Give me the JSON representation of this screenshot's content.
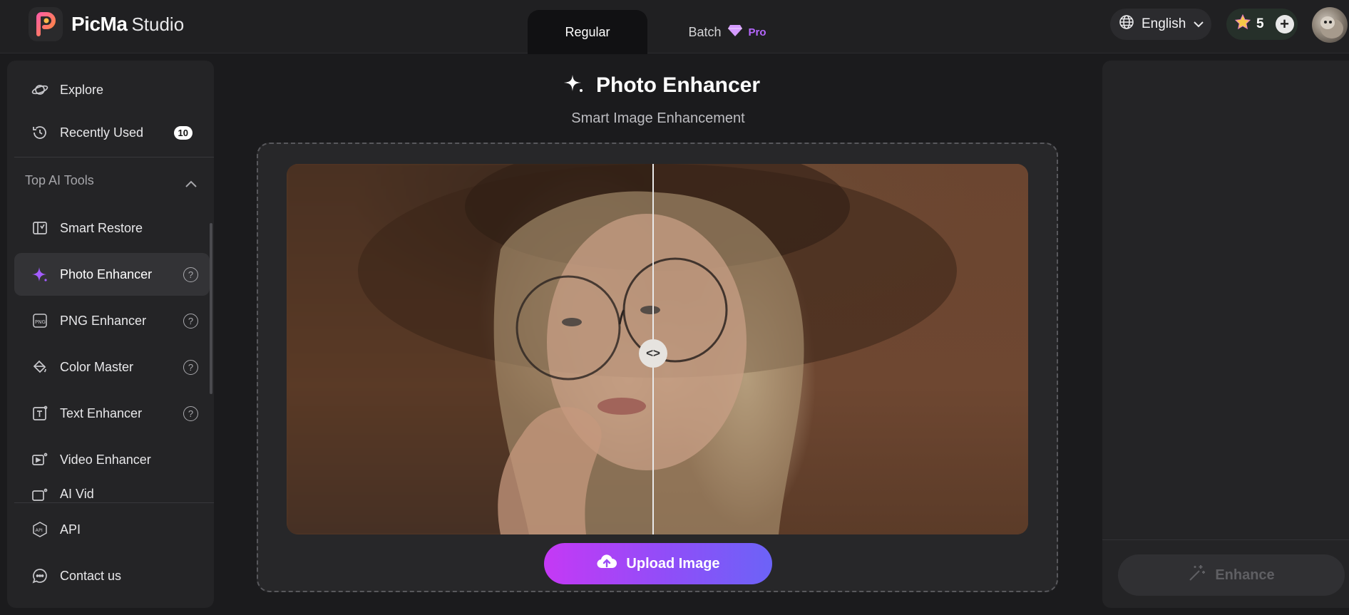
{
  "header": {
    "brand_name": "PicMa",
    "brand_sub": "Studio",
    "tabs": [
      {
        "label": "Regular",
        "active": true
      },
      {
        "label": "Batch",
        "badge": "Pro"
      }
    ],
    "language": "English",
    "credits": "5"
  },
  "sidebar": {
    "top_items": [
      {
        "label": "Explore",
        "icon": "planet-icon"
      },
      {
        "label": "Recently Used",
        "icon": "history-icon",
        "count": "10"
      }
    ],
    "section_title": "Top AI Tools",
    "tools": [
      {
        "label": "Smart Restore",
        "icon": "restore-icon"
      },
      {
        "label": "Photo Enhancer",
        "icon": "sparkle-icon",
        "active": true
      },
      {
        "label": "PNG Enhancer",
        "icon": "png-icon"
      },
      {
        "label": "Color Master",
        "icon": "paint-bucket-icon"
      },
      {
        "label": "Text Enhancer",
        "icon": "text-icon"
      },
      {
        "label": "Video Enhancer",
        "icon": "video-icon"
      },
      {
        "label": "AI Vid",
        "icon": "video-icon"
      }
    ],
    "bottom_items": [
      {
        "label": "API",
        "icon": "api-icon"
      },
      {
        "label": "Contact us",
        "icon": "chat-icon"
      }
    ]
  },
  "main": {
    "title": "Photo Enhancer",
    "subtitle": "Smart Image Enhancement",
    "upload_label": "Upload Image"
  },
  "right_panel": {
    "enhance_label": "Enhance"
  },
  "colors": {
    "accent_start": "#c539f5",
    "accent_end": "#6c63f7",
    "active_icon": "#a35cff"
  }
}
